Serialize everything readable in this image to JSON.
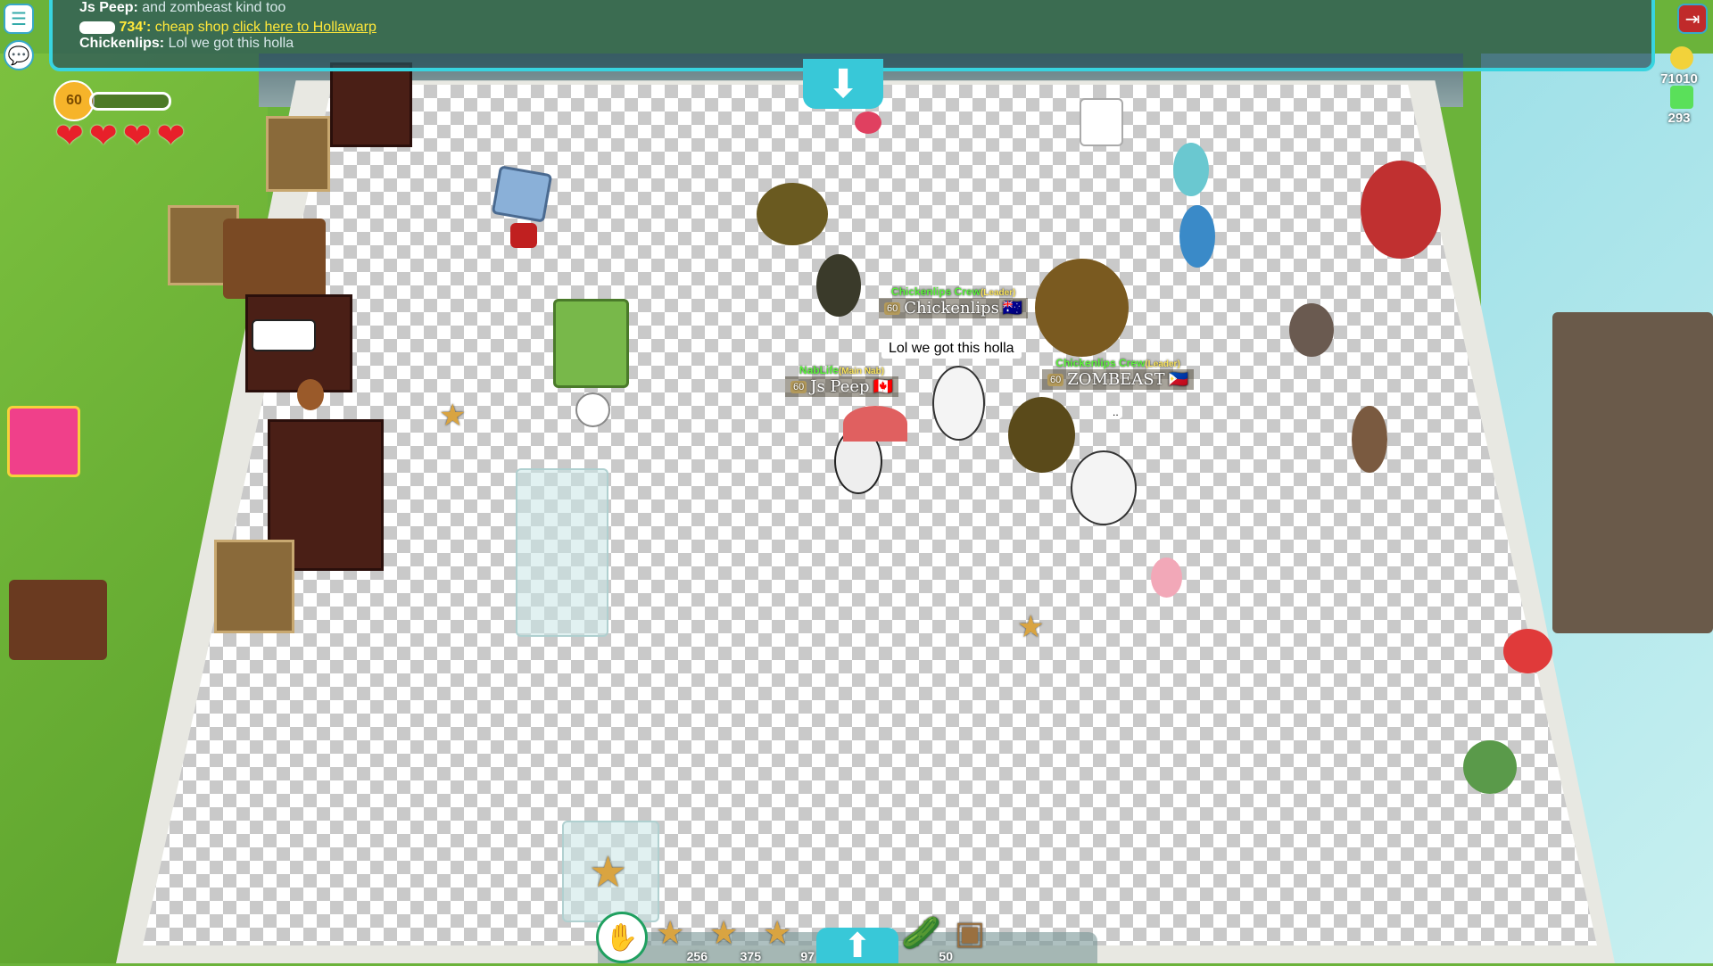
{
  "chat": {
    "lines": [
      {
        "name": "Js Peep:",
        "text": "and zombeast kind too"
      },
      {
        "name": "734':",
        "text": "cheap shop",
        "link": "click here to Hollawarp"
      },
      {
        "name": "Chickenlips:",
        "text": "Lol we got this holla"
      }
    ]
  },
  "hud": {
    "level": "60",
    "hearts": 4,
    "coins": "71010",
    "gems": "293"
  },
  "players": [
    {
      "clan": "Chickenlips Crew",
      "role": "(Leader)",
      "level": "60",
      "name": "Chickenlips",
      "flag": "🇦🇺"
    },
    {
      "clan": "NabLife",
      "role": "(Main Nab)",
      "level": "60",
      "name": "Js Peep",
      "flag": "🇨🇦"
    },
    {
      "clan": "Chickenlips Crew",
      "role": "(Leader)",
      "level": "60",
      "name": "ZOMBEAST",
      "flag": "🇵🇭"
    }
  ],
  "speech": {
    "main": "Lol we got this holla",
    "small": ".."
  },
  "hotbar": {
    "slots": [
      {
        "icon": "star-icon",
        "count": "256"
      },
      {
        "icon": "star-icon",
        "count": "375"
      },
      {
        "icon": "star-icon",
        "count": "97"
      },
      {
        "icon": "cucumber-icon",
        "count": "50"
      }
    ]
  },
  "colors": {
    "accent": "#38d4e0",
    "clan_name": "#5af03a",
    "heart": "#e8202a"
  }
}
